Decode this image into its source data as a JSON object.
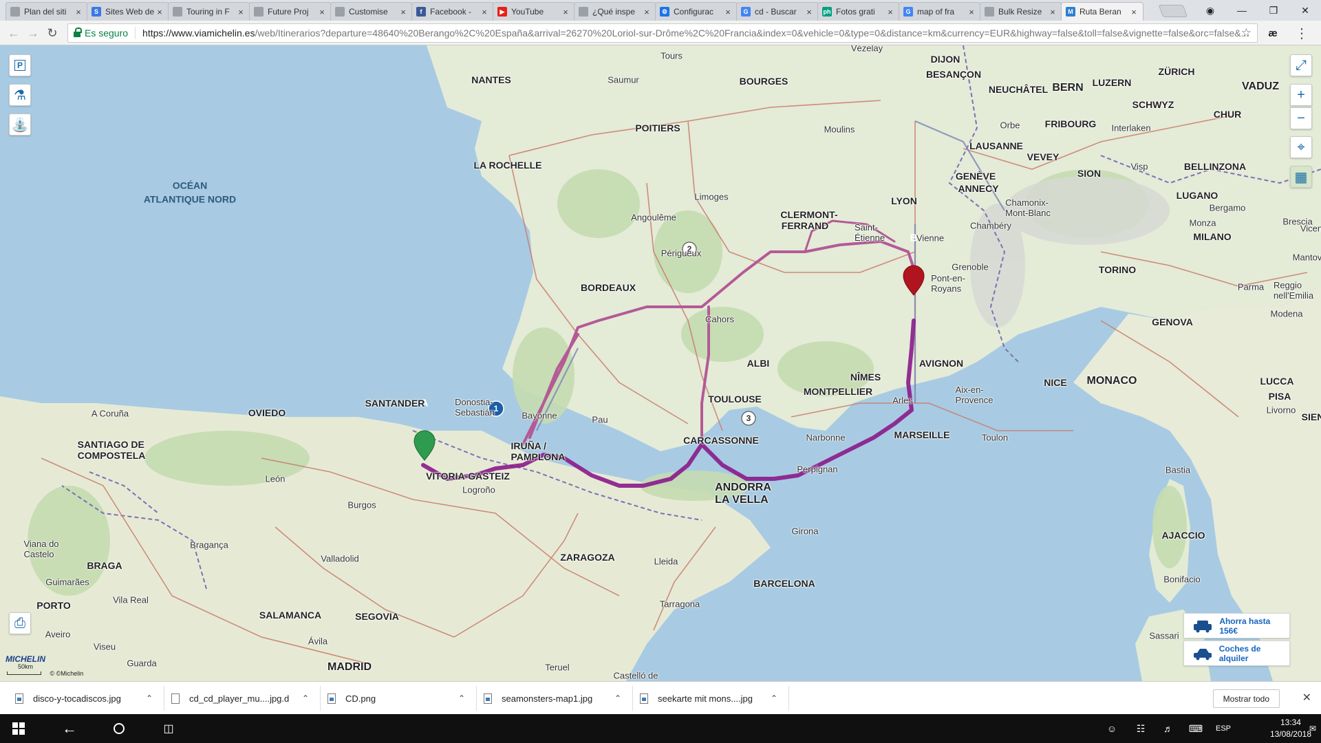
{
  "tabs": [
    {
      "title": "Plan del siti",
      "icon": "page-icon"
    },
    {
      "title": "Sites Web de",
      "icon": "sites-icon"
    },
    {
      "title": "Touring in F",
      "icon": "page-icon"
    },
    {
      "title": "Future Proj",
      "icon": "page-icon"
    },
    {
      "title": "Customise",
      "icon": "page-icon"
    },
    {
      "title": "Facebook -",
      "icon": "facebook-icon"
    },
    {
      "title": "YouTube",
      "icon": "youtube-icon"
    },
    {
      "title": "¿Qué inspe",
      "icon": "page-icon"
    },
    {
      "title": "Configurac",
      "icon": "gear-icon"
    },
    {
      "title": "cd - Buscar",
      "icon": "google-icon"
    },
    {
      "title": "Fotos grati",
      "icon": "ph-icon"
    },
    {
      "title": "map of fra",
      "icon": "google-icon"
    },
    {
      "title": "Bulk Resize",
      "icon": "page-icon"
    },
    {
      "title": "Ruta Beran",
      "icon": "michelin-icon"
    }
  ],
  "address": {
    "secure_label": "Es seguro",
    "url_host": "https://www.viamichelin.es",
    "url_path": "/web/Itinerarios?departure=48640%20Berango%2C%20España&arrival=26270%20Loriol-sur-Drôme%2C%20Francia&index=0&vehicle=0&type=0&distance=km&currency=EUR&highway=false&toll=false&vignette=false&orc=false&..."
  },
  "map": {
    "labels": {
      "ocean": "OCÉAN",
      "ocean2": "ATLANTIQUE NORD",
      "nantes": "NANTES",
      "tours": "Tours",
      "saumur": "Saumur",
      "bourges": "BOURGES",
      "vezelay": "Vézelay",
      "dijon": "DIJON",
      "besancon": "BESANÇON",
      "neuchatel": "NEUCHÂTEL",
      "bern": "BERN",
      "luzern": "LUZERN",
      "zurich": "ZÜRICH",
      "vaduz": "VADUZ",
      "schwyz": "SCHWYZ",
      "chur": "CHUR",
      "poitiers": "POITIERS",
      "moulins": "Moulins",
      "orbe": "Orbe",
      "fribourg": "FRIBOURG",
      "interlaken": "Interlaken",
      "larochelle": "LA ROCHELLE",
      "lausanne": "LAUSANNE",
      "vevey": "VEVEY",
      "sion": "SION",
      "visp": "Visp",
      "bellinzona": "BELLINZONA",
      "geneve": "GENÈVE",
      "annecy": "ANNECY",
      "lugano": "LUGANO",
      "limoges": "Limoges",
      "lyon": "LYON",
      "chamonix": "Chamonix-\nMont-Blanc",
      "bergamo": "Bergamo",
      "clermont": "CLERMONT-",
      "clermont2": "FERRAND",
      "angouleme": "Angoulême",
      "monza": "Monza",
      "brescia": "Brescia",
      "saintetienne": "Saint-\nÉtienne",
      "chambery": "Chambéry",
      "milano": "MILANO",
      "perigueux": "Périgueux",
      "vienne": "Vienne",
      "bordeaux": "BORDEAUX",
      "grenoble": "Grenoble",
      "torino": "TORINO",
      "pontenroyans": "Pont-en-\nRoyans",
      "parma": "Parma",
      "reggio": "Reggio\nnell'Emilia",
      "modena": "Modena",
      "cahors": "Cahors",
      "genova": "GENOVA",
      "albi": "ALBI",
      "avignon": "AVIGNON",
      "nimes": "NÎMES",
      "toulouse": "TOULOUSE",
      "montpellier": "MONTPELLIER",
      "aix": "Aix-en-\nProvence",
      "arles": "Arles",
      "nice": "NICE",
      "monaco": "MONACO",
      "lucca": "LUCCA",
      "pisa": "PISA",
      "livorno": "Livorno",
      "santander": "SANTANDER",
      "oviedo": "OVIEDO",
      "acoruna": "A Coruña",
      "donostia": "Donostia-\nSebastián",
      "bayonne": "Bayonne",
      "pau": "Pau",
      "carcassonne": "CARCASSONNE",
      "narbonne": "Narbonne",
      "marseille": "MARSEILLE",
      "toulon": "Toulon",
      "santiago": "SANTIAGO DE\nCOMPOSTELA",
      "iruna": "IRUÑA /\nPAMPLONA",
      "vitoria": "VITORIA-GASTEIZ",
      "leon": "León",
      "logrono": "Logroño",
      "andorra": "ANDORRA\nLA VELLA",
      "perpignan": "Perpignan",
      "burgos": "Burgos",
      "bastia": "Bastia",
      "girona": "Girona",
      "vianadocastelo": "Viana do\nCastelo",
      "braganca": "Bragança",
      "braga": "BRAGA",
      "valladolid": "Valladolid",
      "zaragoza": "ZARAGOZA",
      "lleida": "Lleida",
      "ajaccio": "AJACCIO",
      "guimaraes": "Guimarães",
      "porto": "PORTO",
      "vilareal": "Vila Real",
      "barcelona": "BARCELONA",
      "bonifacio": "Bonifacio",
      "salamanca": "SALAMANCA",
      "segovia": "SEGOVIA",
      "tarragona": "Tarragona",
      "aveiro": "Aveiro",
      "viseu": "Viseu",
      "avila": "Ávila",
      "sassari": "Sassari",
      "guarda": "Guarda",
      "madrid": "MADRID",
      "teruel": "Teruel",
      "castellodela": "Castelló de",
      "vicen": "Vicen",
      "mantov": "Mantov",
      "sien": "SIEN"
    },
    "markers": {
      "start": "A",
      "end": "B",
      "step1": "1",
      "step2": "2",
      "step3": "3"
    },
    "promo_savings": "Ahorra hasta 156€",
    "promo_rental": "Coches de alquiler",
    "scale": "50km",
    "copyright": "© ©Michelin",
    "logo": "MICHELIN",
    "colors": {
      "route": "#8c1d8c",
      "route_alt": "#b2478f",
      "start_pin": "#2e9b4e",
      "end_pin": "#b0141e",
      "step": "#1b5fa8"
    }
  },
  "downloads": [
    {
      "name": "disco-y-tocadiscos.jpg",
      "type": "img"
    },
    {
      "name": "cd_cd_player_mu....jpg.d",
      "type": "file"
    },
    {
      "name": "CD.png",
      "type": "img"
    },
    {
      "name": "seamonsters-map1.jpg",
      "type": "img"
    },
    {
      "name": "seekarte mit mons....jpg",
      "type": "img"
    }
  ],
  "shelf": {
    "show_all": "Mostrar todo"
  },
  "taskbar": {
    "time": "13:34",
    "date": "13/08/2018",
    "lang": "ESP"
  }
}
